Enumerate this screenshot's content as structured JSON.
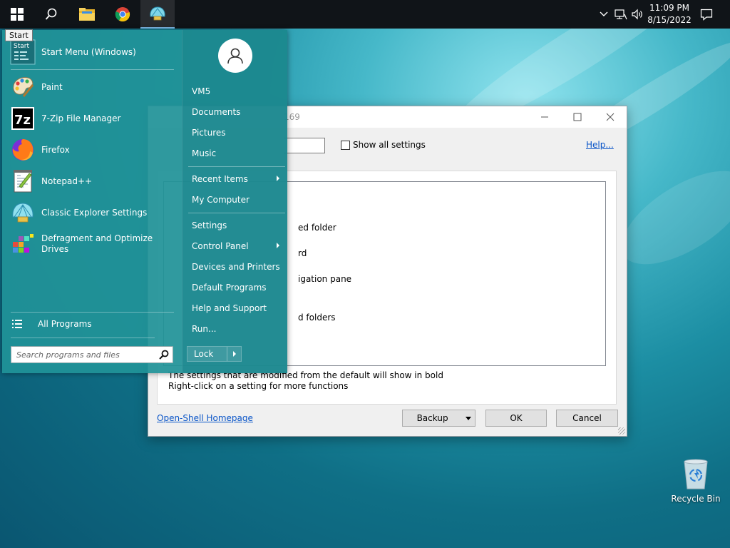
{
  "taskbar": {
    "icons": [
      "windows-start-icon",
      "search-icon",
      "file-explorer-icon",
      "chrome-icon",
      "classic-shell-icon"
    ],
    "clock_time": "11:09 PM",
    "clock_date": "8/15/2022"
  },
  "start_tooltip": "Start",
  "start_menu": {
    "pinned": [
      {
        "label": "Start Menu (Windows)",
        "icon": "start-menu-icon"
      },
      {
        "label": "Paint",
        "icon": "paint-icon"
      },
      {
        "label": "7-Zip File Manager",
        "icon": "7zip-icon"
      },
      {
        "label": "Firefox",
        "icon": "firefox-icon"
      },
      {
        "label": "Notepad++",
        "icon": "notepadpp-icon"
      },
      {
        "label": "Classic Explorer Settings",
        "icon": "classic-explorer-icon"
      },
      {
        "label": "Defragment and Optimize Drives",
        "icon": "defrag-icon"
      }
    ],
    "start_icon_text": "Start",
    "sevenzip_icon_text": "7z",
    "all_programs": "All Programs",
    "search_placeholder": "Search programs and files",
    "right_items": [
      {
        "label": "VM5"
      },
      {
        "label": "Documents"
      },
      {
        "label": "Pictures"
      },
      {
        "label": "Music"
      },
      {
        "label": "Recent Items"
      },
      {
        "label": "My Computer"
      },
      {
        "label": "Settings"
      },
      {
        "label": "Control Panel"
      },
      {
        "label": "Devices and Printers"
      },
      {
        "label": "Default Programs"
      },
      {
        "label": "Help and Support"
      },
      {
        "label": "Run..."
      }
    ],
    "lock_label": "Lock"
  },
  "settings_window": {
    "title_fragment": "169",
    "show_all_settings": "Show all settings",
    "help_link": "Help...",
    "tree_items": [
      "ed folder",
      "rd",
      "igation pane",
      "d folders"
    ],
    "info_line_1": "The settings that are modified from the default will show in bold",
    "info_line_2": "Right-click on a setting for more functions",
    "homepage_link": "Open-Shell Homepage",
    "backup_button": "Backup",
    "ok_button": "OK",
    "cancel_button": "Cancel"
  },
  "desktop": {
    "recycle_bin": "Recycle Bin"
  }
}
